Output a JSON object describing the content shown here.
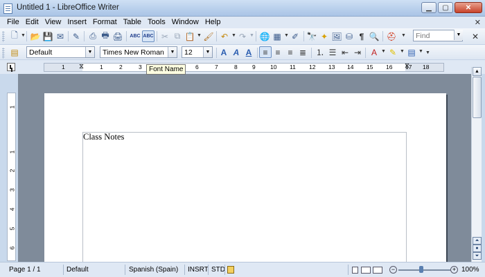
{
  "window": {
    "title": "Untitled 1 - LibreOffice Writer"
  },
  "menu": {
    "items": [
      "File",
      "Edit",
      "View",
      "Insert",
      "Format",
      "Table",
      "Tools",
      "Window",
      "Help"
    ],
    "close_glyph": "✕"
  },
  "toolbar": {
    "find_placeholder": "Find",
    "paragraph_style": "Default",
    "font_name": "Times New Roman",
    "font_size": "12"
  },
  "tooltip": "Font Name",
  "ruler": {
    "h_labels": [
      "1",
      "1",
      "2",
      "3",
      "4",
      "5",
      "6",
      "7",
      "8",
      "9",
      "10",
      "11",
      "12",
      "13",
      "14",
      "15",
      "16",
      "17",
      "18"
    ],
    "v_labels": [
      "1",
      "1",
      "2",
      "3",
      "4",
      "5",
      "6"
    ]
  },
  "document": {
    "text": "Class Notes"
  },
  "status": {
    "page": "Page 1 / 1",
    "style": "Default",
    "language": "Spanish (Spain)",
    "insert_mode": "INSRT",
    "selection_mode": "STD",
    "zoom": "100%"
  }
}
